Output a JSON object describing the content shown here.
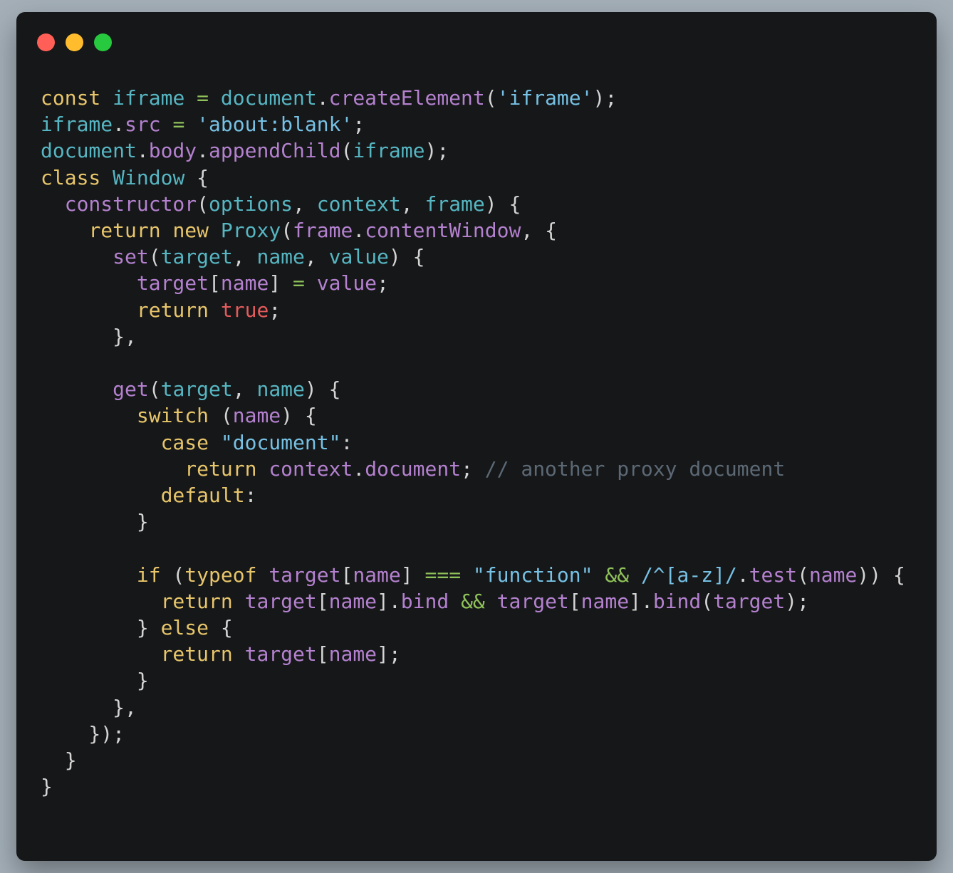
{
  "window": {
    "colors": {
      "background": "#161719",
      "close": "#ff5f56",
      "minimize": "#ffbd2e",
      "maximize": "#27c93f"
    }
  },
  "colors": {
    "k": "#e7c56a",
    "v": "#56b6c2",
    "p": "#b481cf",
    "s": "#76c1e4",
    "n": "#d4d4d4",
    "o": "#8fc25a",
    "c": "#5c6975",
    "b": "#e45b5b"
  },
  "code": {
    "lines": [
      [
        [
          "k",
          "const"
        ],
        [
          "n",
          " "
        ],
        [
          "v",
          "iframe"
        ],
        [
          "n",
          " "
        ],
        [
          "o",
          "="
        ],
        [
          "n",
          " "
        ],
        [
          "v",
          "document"
        ],
        [
          "n",
          "."
        ],
        [
          "p",
          "createElement"
        ],
        [
          "n",
          "("
        ],
        [
          "s",
          "'iframe'"
        ],
        [
          "n",
          ");"
        ]
      ],
      [
        [
          "v",
          "iframe"
        ],
        [
          "n",
          "."
        ],
        [
          "p",
          "src"
        ],
        [
          "n",
          " "
        ],
        [
          "o",
          "="
        ],
        [
          "n",
          " "
        ],
        [
          "s",
          "'about:blank'"
        ],
        [
          "n",
          ";"
        ]
      ],
      [
        [
          "v",
          "document"
        ],
        [
          "n",
          "."
        ],
        [
          "p",
          "body"
        ],
        [
          "n",
          "."
        ],
        [
          "p",
          "appendChild"
        ],
        [
          "n",
          "("
        ],
        [
          "v",
          "iframe"
        ],
        [
          "n",
          ");"
        ]
      ],
      [
        [
          "k",
          "class"
        ],
        [
          "n",
          " "
        ],
        [
          "v",
          "Window"
        ],
        [
          "n",
          " {"
        ]
      ],
      [
        [
          "n",
          "  "
        ],
        [
          "p",
          "constructor"
        ],
        [
          "n",
          "("
        ],
        [
          "v",
          "options"
        ],
        [
          "n",
          ", "
        ],
        [
          "v",
          "context"
        ],
        [
          "n",
          ", "
        ],
        [
          "v",
          "frame"
        ],
        [
          "n",
          ") {"
        ]
      ],
      [
        [
          "n",
          "    "
        ],
        [
          "k",
          "return"
        ],
        [
          "n",
          " "
        ],
        [
          "k",
          "new"
        ],
        [
          "n",
          " "
        ],
        [
          "v",
          "Proxy"
        ],
        [
          "n",
          "("
        ],
        [
          "p",
          "frame"
        ],
        [
          "n",
          "."
        ],
        [
          "p",
          "contentWindow"
        ],
        [
          "n",
          ", {"
        ]
      ],
      [
        [
          "n",
          "      "
        ],
        [
          "p",
          "set"
        ],
        [
          "n",
          "("
        ],
        [
          "v",
          "target"
        ],
        [
          "n",
          ", "
        ],
        [
          "v",
          "name"
        ],
        [
          "n",
          ", "
        ],
        [
          "v",
          "value"
        ],
        [
          "n",
          ") {"
        ]
      ],
      [
        [
          "n",
          "        "
        ],
        [
          "p",
          "target"
        ],
        [
          "n",
          "["
        ],
        [
          "p",
          "name"
        ],
        [
          "n",
          "] "
        ],
        [
          "o",
          "="
        ],
        [
          "n",
          " "
        ],
        [
          "p",
          "value"
        ],
        [
          "n",
          ";"
        ]
      ],
      [
        [
          "n",
          "        "
        ],
        [
          "k",
          "return"
        ],
        [
          "n",
          " "
        ],
        [
          "b",
          "true"
        ],
        [
          "n",
          ";"
        ]
      ],
      [
        [
          "n",
          "      },"
        ]
      ],
      [],
      [
        [
          "n",
          "      "
        ],
        [
          "p",
          "get"
        ],
        [
          "n",
          "("
        ],
        [
          "v",
          "target"
        ],
        [
          "n",
          ", "
        ],
        [
          "v",
          "name"
        ],
        [
          "n",
          ") {"
        ]
      ],
      [
        [
          "n",
          "        "
        ],
        [
          "k",
          "switch"
        ],
        [
          "n",
          " ("
        ],
        [
          "p",
          "name"
        ],
        [
          "n",
          ") {"
        ]
      ],
      [
        [
          "n",
          "          "
        ],
        [
          "k",
          "case"
        ],
        [
          "n",
          " "
        ],
        [
          "s",
          "\"document\""
        ],
        [
          "n",
          ":"
        ]
      ],
      [
        [
          "n",
          "            "
        ],
        [
          "k",
          "return"
        ],
        [
          "n",
          " "
        ],
        [
          "p",
          "context"
        ],
        [
          "n",
          "."
        ],
        [
          "p",
          "document"
        ],
        [
          "n",
          "; "
        ],
        [
          "c",
          "// another proxy document"
        ]
      ],
      [
        [
          "n",
          "          "
        ],
        [
          "k",
          "default"
        ],
        [
          "n",
          ":"
        ]
      ],
      [
        [
          "n",
          "        }"
        ]
      ],
      [],
      [
        [
          "n",
          "        "
        ],
        [
          "k",
          "if"
        ],
        [
          "n",
          " ("
        ],
        [
          "k",
          "typeof"
        ],
        [
          "n",
          " "
        ],
        [
          "p",
          "target"
        ],
        [
          "n",
          "["
        ],
        [
          "p",
          "name"
        ],
        [
          "n",
          "] "
        ],
        [
          "o",
          "==="
        ],
        [
          "n",
          " "
        ],
        [
          "s",
          "\"function\""
        ],
        [
          "n",
          " "
        ],
        [
          "o",
          "&&"
        ],
        [
          "n",
          " "
        ],
        [
          "s",
          "/^[a-z]/"
        ],
        [
          "n",
          "."
        ],
        [
          "p",
          "test"
        ],
        [
          "n",
          "("
        ],
        [
          "p",
          "name"
        ],
        [
          "n",
          ")) {"
        ]
      ],
      [
        [
          "n",
          "          "
        ],
        [
          "k",
          "return"
        ],
        [
          "n",
          " "
        ],
        [
          "p",
          "target"
        ],
        [
          "n",
          "["
        ],
        [
          "p",
          "name"
        ],
        [
          "n",
          "]."
        ],
        [
          "p",
          "bind"
        ],
        [
          "n",
          " "
        ],
        [
          "o",
          "&&"
        ],
        [
          "n",
          " "
        ],
        [
          "p",
          "target"
        ],
        [
          "n",
          "["
        ],
        [
          "p",
          "name"
        ],
        [
          "n",
          "]."
        ],
        [
          "p",
          "bind"
        ],
        [
          "n",
          "("
        ],
        [
          "p",
          "target"
        ],
        [
          "n",
          ");"
        ]
      ],
      [
        [
          "n",
          "        } "
        ],
        [
          "k",
          "else"
        ],
        [
          "n",
          " {"
        ]
      ],
      [
        [
          "n",
          "          "
        ],
        [
          "k",
          "return"
        ],
        [
          "n",
          " "
        ],
        [
          "p",
          "target"
        ],
        [
          "n",
          "["
        ],
        [
          "p",
          "name"
        ],
        [
          "n",
          "];"
        ]
      ],
      [
        [
          "n",
          "        }"
        ]
      ],
      [
        [
          "n",
          "      },"
        ]
      ],
      [
        [
          "n",
          "    });"
        ]
      ],
      [
        [
          "n",
          "  }"
        ]
      ],
      [
        [
          "n",
          "}"
        ]
      ]
    ]
  }
}
